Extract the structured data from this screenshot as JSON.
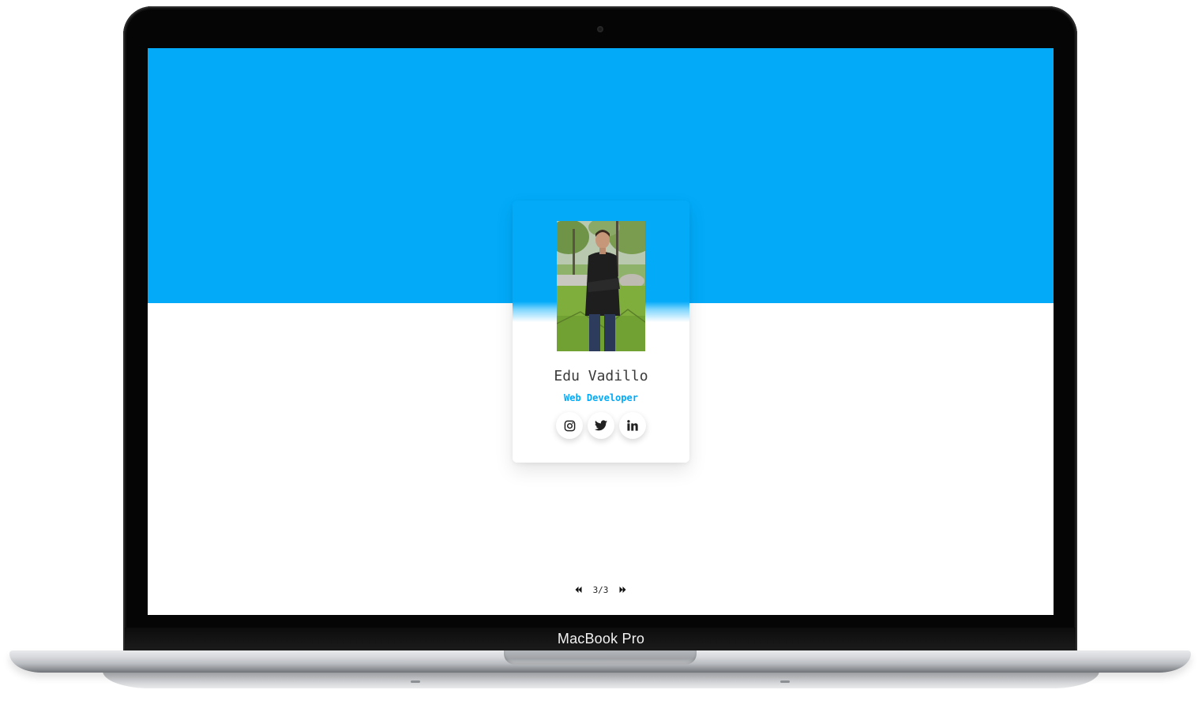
{
  "device": {
    "model_label": "MacBook Pro"
  },
  "colors": {
    "accent": "#02aaf8",
    "name_text": "#3a3a3a",
    "background": "#ffffff"
  },
  "profile_card": {
    "name": "Edu Vadillo",
    "role": "Web Developer",
    "photo_icon": "profile-photo",
    "socials": [
      {
        "icon": "instagram-icon"
      },
      {
        "icon": "twitter-icon"
      },
      {
        "icon": "linkedin-icon"
      }
    ]
  },
  "pagination": {
    "prev_icon": "double-chevron-left-icon",
    "status": "3/3",
    "next_icon": "double-chevron-right-icon"
  }
}
